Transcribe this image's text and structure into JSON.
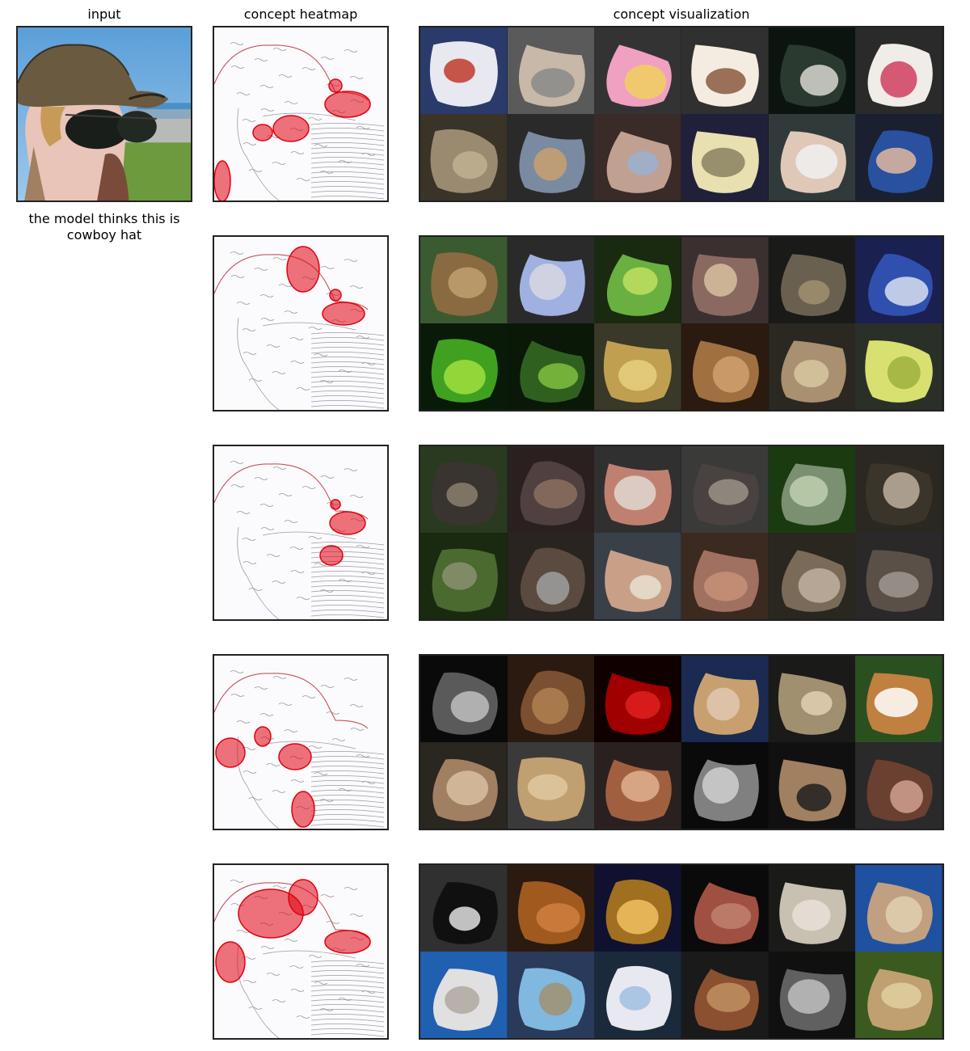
{
  "headers": {
    "input": "input",
    "heatmap": "concept heatmap",
    "visualization": "concept visualization"
  },
  "prediction": {
    "caption": "the model thinks this is cowboy hat"
  },
  "input_image": {
    "icon": "photo-woman-straw-hat-sunglasses"
  },
  "accent_color": "#e0000f",
  "concepts": [
    {
      "heatmap_icon": "heatmap-hat-band-sunglasses",
      "heatmap_focus": "hat band and sunglasses",
      "tiles": [
        {
          "icon": "patterned-slippers",
          "colors": [
            "#2a3a6a",
            "#e8e8f0",
            "#c0392b"
          ]
        },
        {
          "icon": "chair-seat",
          "colors": [
            "#5a5a5a",
            "#c8b8a8",
            "#8a8a8a"
          ]
        },
        {
          "icon": "butterfly-bibs",
          "colors": [
            "#333",
            "#f0a0c0",
            "#f0d060"
          ]
        },
        {
          "icon": "cowboy-hat-face",
          "colors": [
            "#303030",
            "#f4ece0",
            "#8a5a40"
          ]
        },
        {
          "icon": "dark-hat-brim",
          "colors": [
            "#0c1410",
            "#2a3a30",
            "#d8d8d0"
          ]
        },
        {
          "icon": "floral-teapot",
          "colors": [
            "#2a2a2a",
            "#f0ece8",
            "#d04060"
          ]
        },
        {
          "icon": "woven-hat",
          "colors": [
            "#3a3328",
            "#9a8a70",
            "#c0b090"
          ]
        },
        {
          "icon": "sneaker",
          "colors": [
            "#2a2a2a",
            "#7a8aa0",
            "#c8a070"
          ]
        },
        {
          "icon": "baby-portrait",
          "colors": [
            "#3a2a28",
            "#c0a090",
            "#9ab0d0"
          ]
        },
        {
          "icon": "hat-brim-dark",
          "colors": [
            "#20203a",
            "#e8e0b0",
            "#8a8060"
          ]
        },
        {
          "icon": "child-sunglasses",
          "colors": [
            "#303a3a",
            "#e0c8b8",
            "#f0f0f0"
          ]
        },
        {
          "icon": "child-goggles",
          "colors": [
            "#1a2030",
            "#2a50a0",
            "#e0b8a0"
          ]
        }
      ]
    },
    {
      "heatmap_icon": "heatmap-hat-band",
      "heatmap_focus": "hat band",
      "tiles": [
        {
          "icon": "shell-on-grass",
          "colors": [
            "#3a5a30",
            "#8a6a40",
            "#c0a070"
          ]
        },
        {
          "icon": "blue-tape",
          "colors": [
            "#2a2a2a",
            "#a0b0e0",
            "#d8d8e0"
          ]
        },
        {
          "icon": "green-snake",
          "colors": [
            "#1a2a10",
            "#6ab040",
            "#c0e060"
          ]
        },
        {
          "icon": "coiled-python",
          "colors": [
            "#3a3030",
            "#8a6a60",
            "#d8c0a0"
          ]
        },
        {
          "icon": "dark-snake-coil",
          "colors": [
            "#1a1a18",
            "#6a6050",
            "#a09070"
          ]
        },
        {
          "icon": "fabric-floral",
          "colors": [
            "#1a2050",
            "#3050b0",
            "#d8e0f0"
          ]
        },
        {
          "icon": "green-python",
          "colors": [
            "#0a1a08",
            "#40a020",
            "#a0e040"
          ]
        },
        {
          "icon": "green-scales",
          "colors": [
            "#0a1808",
            "#306020",
            "#80c040"
          ]
        },
        {
          "icon": "yellow-snake",
          "colors": [
            "#3a3828",
            "#c0a050",
            "#e8d080"
          ]
        },
        {
          "icon": "hand-snake",
          "colors": [
            "#2a1a10",
            "#a07040",
            "#d0a070"
          ]
        },
        {
          "icon": "sand-snake",
          "colors": [
            "#2a2820",
            "#a89070",
            "#d8c8a0"
          ]
        },
        {
          "icon": "yellow-coil",
          "colors": [
            "#2a3028",
            "#d8e070",
            "#a0b040"
          ]
        }
      ]
    },
    {
      "heatmap_icon": "heatmap-sunglasses",
      "heatmap_focus": "sunglasses",
      "tiles": [
        {
          "icon": "buffalo",
          "colors": [
            "#2a3a20",
            "#3a3430",
            "#8a8070"
          ]
        },
        {
          "icon": "buffalo-horn",
          "colors": [
            "#2a2020",
            "#504040",
            "#8a7060"
          ]
        },
        {
          "icon": "woman-hat",
          "colors": [
            "#303030",
            "#c08070",
            "#e0d8d0"
          ]
        },
        {
          "icon": "buffalo-head",
          "colors": [
            "#3a3a38",
            "#4a4240",
            "#9a9088"
          ]
        },
        {
          "icon": "buffalo-statue",
          "colors": [
            "#1a3a10",
            "#7a9070",
            "#c0d0b0"
          ]
        },
        {
          "icon": "buffalo-herd",
          "colors": [
            "#2a2820",
            "#3a342a",
            "#c0b0a0"
          ]
        },
        {
          "icon": "buffalo-field",
          "colors": [
            "#1a2a10",
            "#4a6a30",
            "#8a9070"
          ]
        },
        {
          "icon": "buffalo-legs",
          "colors": [
            "#2a2420",
            "#5a4a40",
            "#a0a0a0"
          ]
        },
        {
          "icon": "women-cowboy-hats",
          "colors": [
            "#3a4048",
            "#c8a088",
            "#e8e0d0"
          ]
        },
        {
          "icon": "elephant-skin",
          "colors": [
            "#3a2a20",
            "#a07060",
            "#c89078"
          ]
        },
        {
          "icon": "horn-closeup",
          "colors": [
            "#2a2620",
            "#7a6a58",
            "#c0b0a0"
          ]
        },
        {
          "icon": "curled-horn",
          "colors": [
            "#2a2828",
            "#5a5048",
            "#a09890"
          ]
        }
      ]
    },
    {
      "heatmap_icon": "heatmap-face-sunglasses",
      "heatmap_focus": "face and sunglasses",
      "tiles": [
        {
          "icon": "profile-bw",
          "colors": [
            "#0a0a0a",
            "#5a5a5a",
            "#c0c0c0"
          ]
        },
        {
          "icon": "brown-hair",
          "colors": [
            "#2a1a10",
            "#7a5030",
            "#b08050"
          ]
        },
        {
          "icon": "red-face",
          "colors": [
            "#100000",
            "#a00000",
            "#e02020"
          ]
        },
        {
          "icon": "blonde-face",
          "colors": [
            "#1a2a50",
            "#c8a070",
            "#e0c8b0"
          ]
        },
        {
          "icon": "face-closeup",
          "colors": [
            "#1a1a18",
            "#a09070",
            "#e0d0b0"
          ]
        },
        {
          "icon": "beagle",
          "colors": [
            "#2a5020",
            "#c08040",
            "#ffffff"
          ]
        },
        {
          "icon": "boy-sepia",
          "colors": [
            "#2a2620",
            "#a08060",
            "#d8c0a0"
          ]
        },
        {
          "icon": "straw-hat-hair",
          "colors": [
            "#3a3a3a",
            "#c0a070",
            "#e0c8a0"
          ]
        },
        {
          "icon": "girl-hat",
          "colors": [
            "#2a2020",
            "#a06040",
            "#e0b090"
          ]
        },
        {
          "icon": "glasses-bw",
          "colors": [
            "#0a0a0a",
            "#808080",
            "#d0d0d0"
          ]
        },
        {
          "icon": "grad-sunglasses",
          "colors": [
            "#101010",
            "#a08060",
            "#202020"
          ]
        },
        {
          "icon": "surprised-face",
          "colors": [
            "#2a2a2a",
            "#6a4030",
            "#d0a090"
          ]
        }
      ]
    },
    {
      "heatmap_icon": "heatmap-hat-and-face",
      "heatmap_focus": "hat and face",
      "tiles": [
        {
          "icon": "rope-knot-bw",
          "colors": [
            "#303030",
            "#101010",
            "#e0e0e0"
          ]
        },
        {
          "icon": "autumn-leaves",
          "colors": [
            "#2a1a10",
            "#a05a20",
            "#d08040"
          ]
        },
        {
          "icon": "golden-stupa",
          "colors": [
            "#101030",
            "#a07020",
            "#f0c060"
          ]
        },
        {
          "icon": "red-shell",
          "colors": [
            "#0a0a0a",
            "#a05040",
            "#c08070"
          ]
        },
        {
          "icon": "rope-knot-white",
          "colors": [
            "#1a1a18",
            "#c8c0b0",
            "#e8e0d8"
          ]
        },
        {
          "icon": "starfish",
          "colors": [
            "#2050a0",
            "#c0a080",
            "#e0d0b0"
          ]
        },
        {
          "icon": "white-tower",
          "colors": [
            "#2060b0",
            "#e0e0e0",
            "#b0a8a0"
          ]
        },
        {
          "icon": "temple-spires",
          "colors": [
            "#2a3a5a",
            "#80b8e0",
            "#a09070"
          ]
        },
        {
          "icon": "white-temple",
          "colors": [
            "#1a2a3a",
            "#e8e8f0",
            "#a0c0e0"
          ]
        },
        {
          "icon": "crab-closeup",
          "colors": [
            "#1a1a1a",
            "#8a5030",
            "#c09060"
          ]
        },
        {
          "icon": "chain-knot-bw",
          "colors": [
            "#101010",
            "#606060",
            "#c0c0c0"
          ]
        },
        {
          "icon": "leaf-lizard",
          "colors": [
            "#3a5a20",
            "#c0a070",
            "#e0d0a0"
          ]
        }
      ]
    }
  ]
}
